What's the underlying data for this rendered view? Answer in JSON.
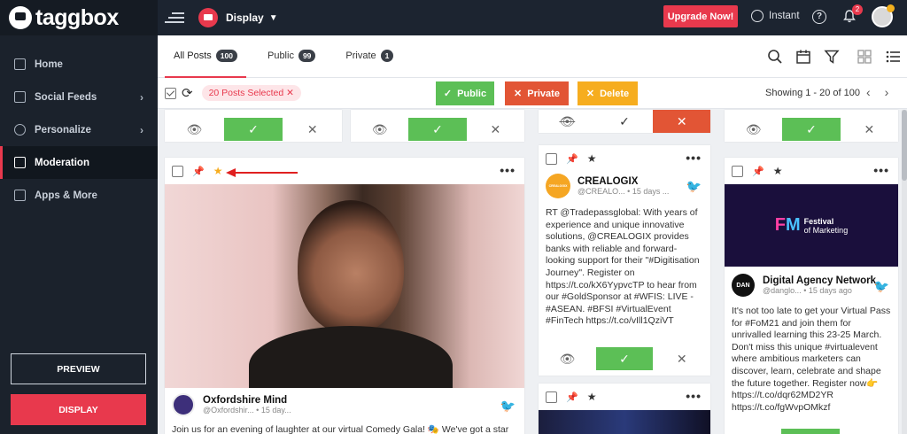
{
  "brand": {
    "name": "taggbox"
  },
  "sidebar": {
    "items": [
      {
        "label": "Home",
        "icon": "home-icon"
      },
      {
        "label": "Social Feeds",
        "icon": "plus-square-icon",
        "has_chevron": true
      },
      {
        "label": "Personalize",
        "icon": "palette-icon",
        "has_chevron": true
      },
      {
        "label": "Moderation",
        "icon": "moderation-icon",
        "active": true
      },
      {
        "label": "Apps & More",
        "icon": "apps-grid-icon"
      }
    ],
    "preview_label": "PREVIEW",
    "display_label": "DISPLAY"
  },
  "topbar": {
    "display_label": "Display",
    "upgrade_label": "Upgrade Now!",
    "instant_label": "Instant",
    "notification_count": "2"
  },
  "tabs": [
    {
      "label": "All Posts",
      "count": "100",
      "active": true
    },
    {
      "label": "Public",
      "count": "99"
    },
    {
      "label": "Private",
      "count": "1"
    }
  ],
  "actions": {
    "selected_label": "20  Posts Selected ✕",
    "public_label": "Public",
    "private_label": "Private",
    "delete_label": "Delete",
    "showing": "Showing 1 - 20 of 100"
  },
  "posts": {
    "oxfordshire": {
      "author": "Oxfordshire Mind",
      "handle": "@Oxfordshir...",
      "time": "• 15 day...",
      "text": "Join us for an evening of laughter at our virtual Comedy Gala! 🎭 We've got a star"
    },
    "crealogix": {
      "author": "CREALOGIX",
      "handle": "@CREALO...",
      "time": "• 15 days ...",
      "logo_text": "CREALOGIX",
      "text": "RT @Tradepassglobal: With years of experience and unique innovative solutions, @CREALOGIX provides banks with reliable and forward-looking support for their \"#Digitisation Journey\". Register on https://t.co/kX6YypvcTP to hear from our #GoldSponsor at #WFIS: LIVE - #ASEAN. #BFSI #VirtualEvent #FinTech https://t.co/vIll1QziVT"
    },
    "digital_agency": {
      "author": "Digital Agency Network",
      "handle": "@danglo...",
      "time": "• 15 days ago",
      "avatar_text": "DAN",
      "banner_title": "Festival",
      "banner_sub": "of Marketing",
      "text": "It's not too late to get your Virtual Pass for #FoM21 and join them for unrivalled learning this 23-25 March. Don't miss this unique #virtualevent where ambitious marketers can discover, learn, celebrate and shape the future together. Register now👉 https://t.co/dqr62MD2YR https://t.co/fgWvpOMkzf"
    }
  },
  "colors": {
    "accent": "#e8394d",
    "approve": "#5cbf56",
    "reject": "#e25535",
    "delete": "#f6ad1f",
    "sidebar_bg": "#1b222c"
  }
}
